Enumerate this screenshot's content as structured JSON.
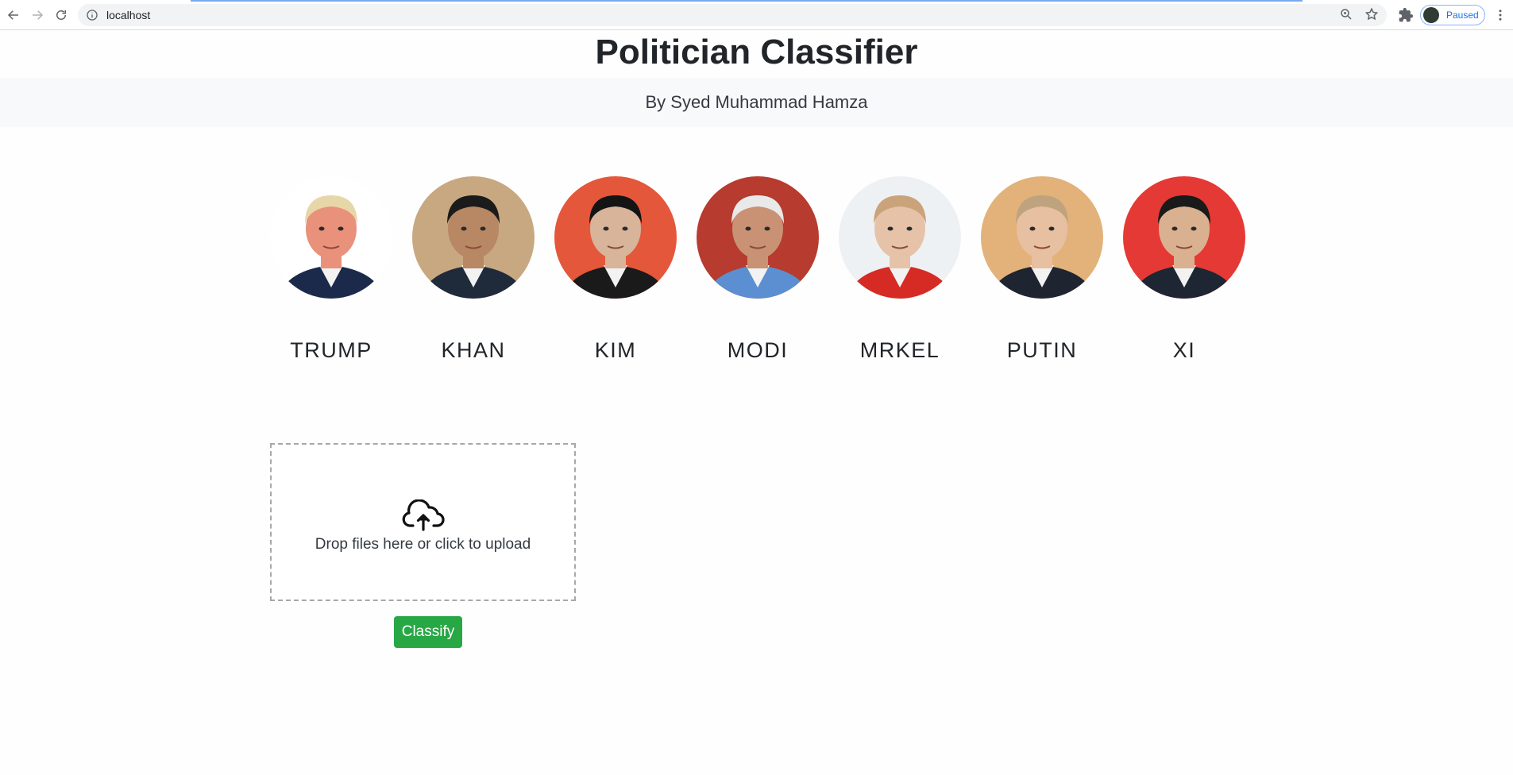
{
  "browser": {
    "url": "localhost",
    "profile_status": "Paused"
  },
  "header": {
    "title": "Politician Classifier",
    "subtitle": "By Syed Muhammad Hamza"
  },
  "politicians": [
    {
      "label": "TRUMP",
      "bg": "#ffffff",
      "skin": "#e9917a",
      "hair": "#e7d7a8",
      "suit": "#1b2a4a"
    },
    {
      "label": "KHAN",
      "bg": "#c8a880",
      "skin": "#b88763",
      "hair": "#1b1b1b",
      "suit": "#1f2a3a"
    },
    {
      "label": "KIM",
      "bg": "#e4573a",
      "skin": "#d7b49a",
      "hair": "#141414",
      "suit": "#1a1a1a"
    },
    {
      "label": "MODI",
      "bg": "#b73b2e",
      "skin": "#c99274",
      "hair": "#e9e9e9",
      "suit": "#5b8fd1"
    },
    {
      "label": "MRKEL",
      "bg": "#eef1f4",
      "skin": "#e6c3a8",
      "hair": "#caa37a",
      "suit": "#d62a24"
    },
    {
      "label": "PUTIN",
      "bg": "#e2b27a",
      "skin": "#e7bfa1",
      "hair": "#bfa37e",
      "suit": "#1e2430"
    },
    {
      "label": "XI",
      "bg": "#e53935",
      "skin": "#d9b190",
      "hair": "#1a1a1a",
      "suit": "#1e2533"
    }
  ],
  "upload": {
    "prompt": "Drop files here or click to upload",
    "icon": "cloud-upload-icon"
  },
  "actions": {
    "classify_label": "Classify",
    "classify_color": "#28a745"
  }
}
